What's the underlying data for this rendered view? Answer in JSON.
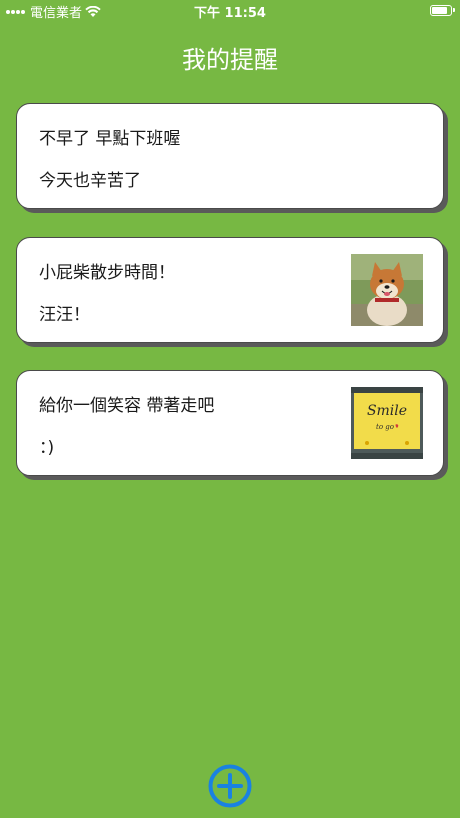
{
  "status_bar": {
    "carrier": "電信業者",
    "time": "下午 11:54"
  },
  "header": {
    "title": "我的提醒"
  },
  "reminders": [
    {
      "title": "不早了 早點下班喔",
      "body": "今天也辛苦了",
      "image": null
    },
    {
      "title": "小屁柴散步時間！",
      "body": "汪汪！",
      "image": "shiba-dog-photo"
    },
    {
      "title": "給你一個笑容 帶著走吧",
      "body": "：)",
      "image": "smile-note-photo",
      "image_text": {
        "line1": "Smile",
        "line2": "to go"
      }
    }
  ],
  "add_button": {
    "icon": "plus-circle-icon",
    "color": "#1a82e2"
  },
  "colors": {
    "background": "#77b843",
    "card": "#ffffff",
    "accent": "#1a82e2"
  }
}
